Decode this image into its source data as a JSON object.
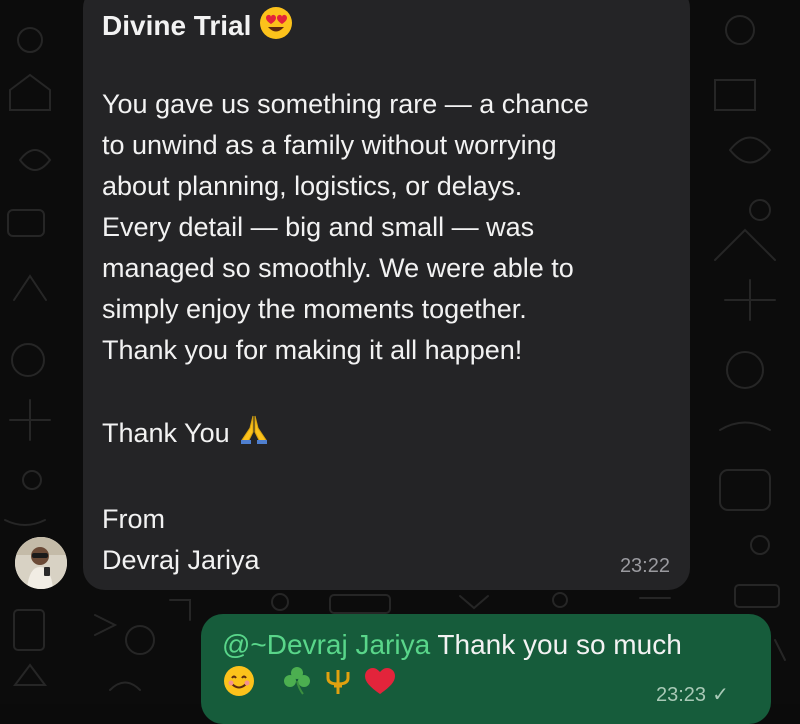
{
  "chat": {
    "incoming": {
      "title": "Divine Trial",
      "title_emoji": "heart-eyes-emoji",
      "lines": [
        "You gave us something rare — a chance",
        "to unwind as a family without worrying",
        "about planning, logistics, or delays.",
        "Every detail — big and small — was",
        "managed so smoothly. We were able to",
        "simply enjoy the moments together.",
        "Thank you for making it all happen!"
      ],
      "thanks": "Thank You",
      "thanks_emoji": "folded-hands-emoji",
      "from_label": "From",
      "signature": "Devraj Jariya",
      "time": "23:22"
    },
    "outgoing": {
      "mention": "@~Devraj Jariya",
      "text": " Thank you so much",
      "emojis": [
        "smiling-face-emoji",
        "shamrock-emoji",
        "trident-emoji",
        "red-heart-emoji"
      ],
      "time": "23:23",
      "status_icon": "single-check-icon"
    },
    "colors": {
      "incoming_bubble": "#242426",
      "outgoing_bubble": "#165c3b",
      "mention": "#59d68a",
      "background": "#0c0c0c"
    }
  }
}
